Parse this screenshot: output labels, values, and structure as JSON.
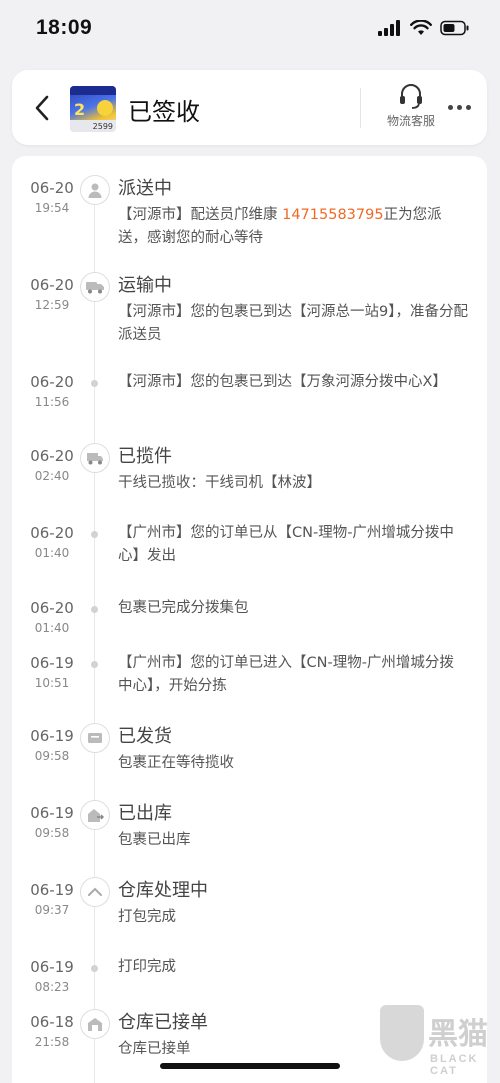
{
  "status_bar": {
    "time": "18:09"
  },
  "header": {
    "title": "已签收",
    "customer_service_label": "物流客服",
    "thumbnail": {
      "number": "2",
      "price": "2599"
    }
  },
  "timeline": [
    {
      "date": "06-20",
      "time": "19:54",
      "status": "派送中",
      "icon": "person-icon",
      "desc_prefix": "【河源市】配送员邝维康 ",
      "phone": "14715583795",
      "desc_suffix": "正为您派送，感谢您的耐心等待"
    },
    {
      "date": "06-20",
      "time": "12:59",
      "status": "运输中",
      "icon": "truck-icon",
      "desc": "【河源市】您的包裹已到达【河源总一站9】，准备分配派送员"
    },
    {
      "date": "06-20",
      "time": "11:56",
      "status": "",
      "desc": "【河源市】您的包裹已到达【万象河源分拨中心X】"
    },
    {
      "date": "06-20",
      "time": "02:40",
      "status": "已揽件",
      "icon": "van-icon",
      "desc": "干线已揽收：干线司机【林波】"
    },
    {
      "date": "06-20",
      "time": "01:40",
      "status": "",
      "desc": "【广州市】您的订单已从【CN-理物-广州增城分拨中心】发出"
    },
    {
      "date": "06-20",
      "time": "01:40",
      "status": "",
      "desc": "包裹已完成分拨集包"
    },
    {
      "date": "06-19",
      "time": "10:51",
      "status": "",
      "desc": "【广州市】您的订单已进入【CN-理物-广州增城分拨中心】，开始分拣"
    },
    {
      "date": "06-19",
      "time": "09:58",
      "status": "已发货",
      "icon": "package-icon",
      "desc": "包裹正在等待揽收"
    },
    {
      "date": "06-19",
      "time": "09:58",
      "status": "已出库",
      "icon": "warehouse-out-icon",
      "desc": "包裹已出库"
    },
    {
      "date": "06-19",
      "time": "09:37",
      "status": "仓库处理中",
      "icon": "chevron-up-icon",
      "desc": "打包完成"
    },
    {
      "date": "06-19",
      "time": "08:23",
      "status": "",
      "desc": "打印完成"
    },
    {
      "date": "06-18",
      "time": "21:58",
      "status": "仓库已接单",
      "icon": "warehouse-icon",
      "desc": "仓库已接单"
    }
  ],
  "watermark": {
    "text": "黑猫",
    "sub": "BLACK CAT"
  }
}
